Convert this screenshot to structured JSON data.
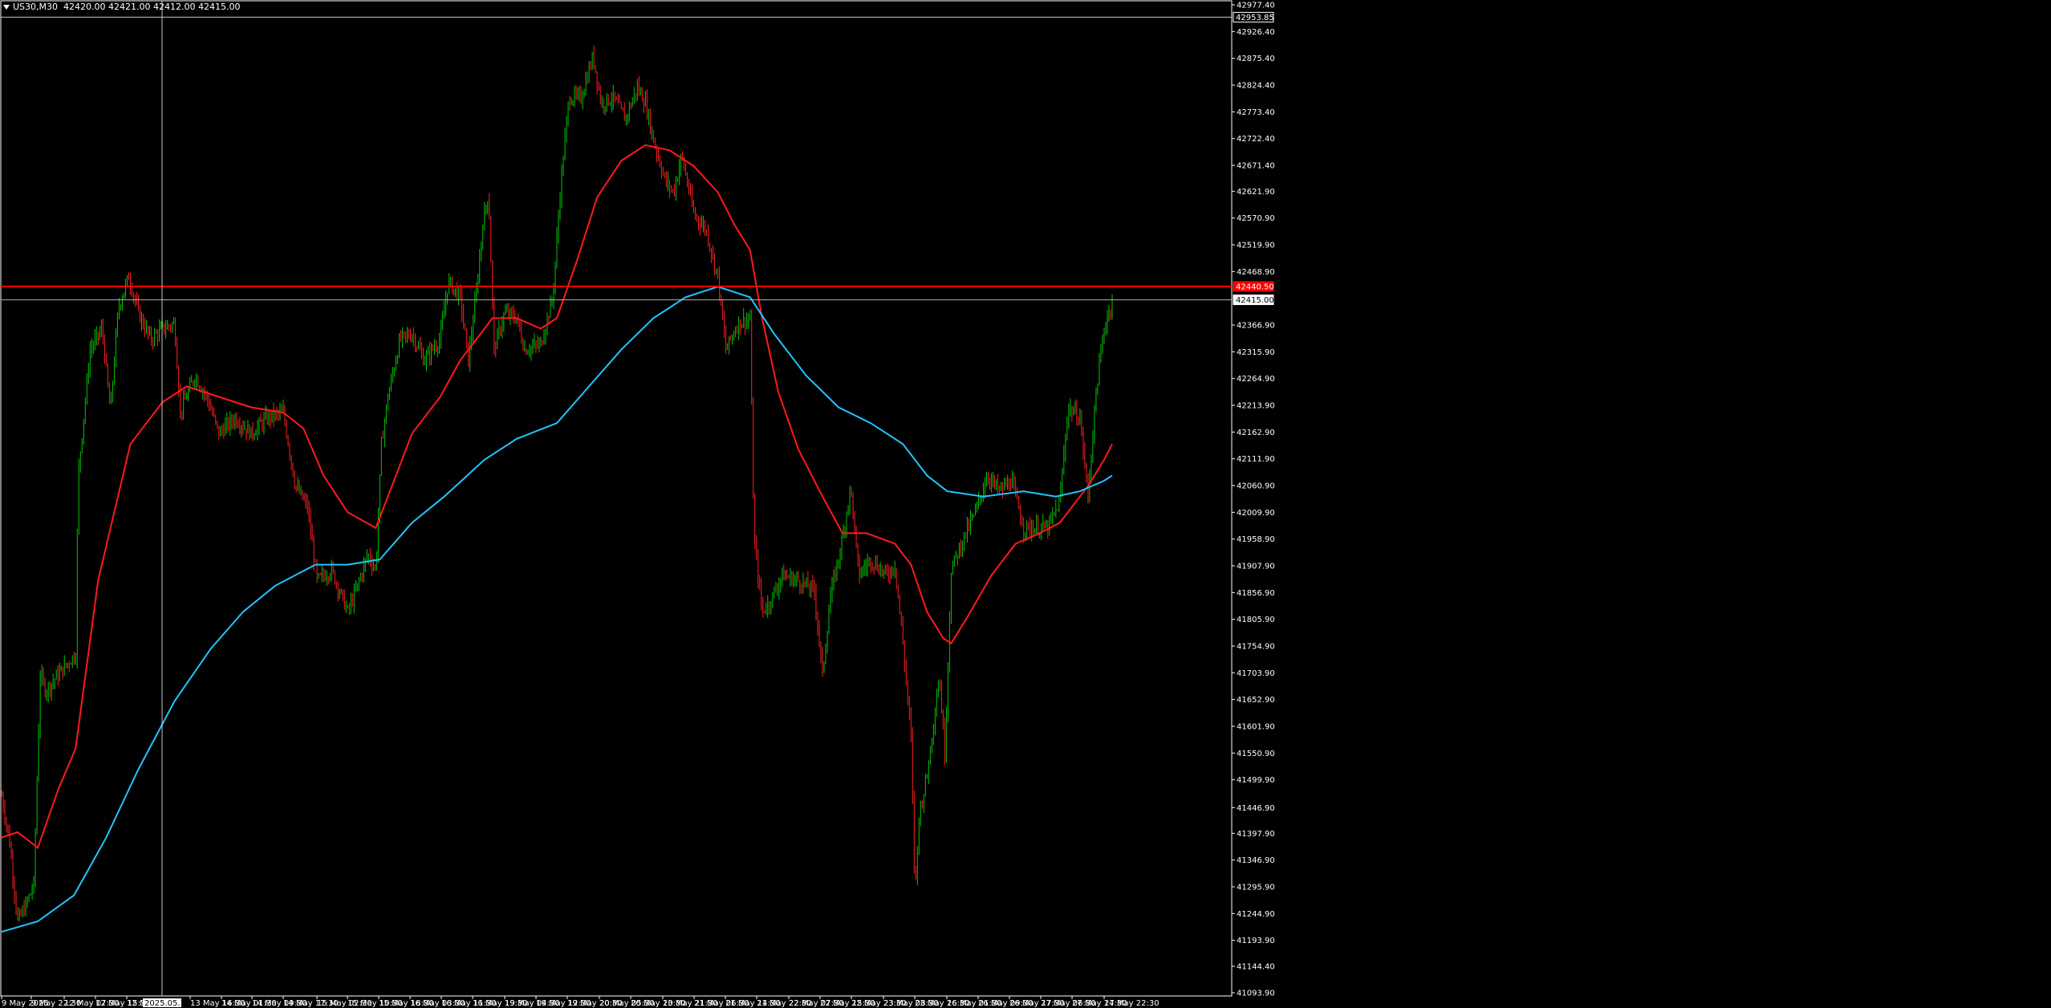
{
  "header": {
    "symbol": "US30,M30",
    "ohlc": "42420.00 42421.00 42412.00 42415.00"
  },
  "colors": {
    "background": "#000000",
    "bull": "#00c800",
    "bear": "#ff2020",
    "ma_fast": "#ff1a1a",
    "ma_slow": "#22c4ff",
    "hline": "#ff0000",
    "frame": "#ffffff",
    "crosshair": "#c8c8c8"
  },
  "chart_data": {
    "type": "candlestick",
    "symbol": "US30",
    "timeframe": "M30",
    "ylim": [
      41093.9,
      42977.4
    ],
    "price_ticks": [
      "42977.40",
      "42926.40",
      "42875.40",
      "42824.40",
      "42773.40",
      "42722.40",
      "42671.40",
      "42621.90",
      "42570.90",
      "42519.90",
      "42468.90",
      "42366.90",
      "42315.90",
      "42264.90",
      "42213.90",
      "42162.90",
      "42111.90",
      "42060.90",
      "42009.90",
      "41958.90",
      "41907.90",
      "41856.90",
      "41805.90",
      "41754.90",
      "41703.90",
      "41652.90",
      "41601.90",
      "41550.90",
      "41499.90",
      "41446.90",
      "41397.90",
      "41346.90",
      "41295.90",
      "41244.90",
      "41193.90",
      "41144.40",
      "41093.90"
    ],
    "time_labels": [
      "9 May 2025",
      "9 May 22:30",
      "12 May 07:30",
      "12 May 15:30",
      "12 May",
      "2025.05.13 09:00",
      "13 May 16:30",
      "14 May 01:30",
      "14 May 09:30",
      "14 May 17:30",
      "15 May 02:30",
      "15 May 10:30",
      "15 May 18:30",
      "16 May 03:30",
      "16 May 11:30",
      "16 May 19:30",
      "19 May 04:30",
      "19 May 12:30",
      "19 May 20:30",
      "20 May 05:30",
      "20 May 13:30",
      "20 May 21:30",
      "21 May 06:30",
      "21 May 14:30",
      "21 May 22:30",
      "22 May 07:30",
      "22 May 15:30",
      "22 May 23:30",
      "23 May 08:30",
      "23 May 16:30",
      "26 May 01:30",
      "26 May 09:30",
      "26 May 17:30",
      "27 May 06:30",
      "27 May 14:30",
      "27 May 22:30"
    ],
    "crosshair_time": "2025.05.13 09:00",
    "crosshair_price": "42953.85",
    "ask_price": "42440.50",
    "bid_price": "42415.00",
    "price_path": [
      [
        0,
        41470
      ],
      [
        10,
        41380
      ],
      [
        20,
        41230
      ],
      [
        30,
        41260
      ],
      [
        40,
        41300
      ],
      [
        48,
        41700
      ],
      [
        55,
        41670
      ],
      [
        70,
        41700
      ],
      [
        92,
        41740
      ],
      [
        95,
        42080
      ],
      [
        110,
        42320
      ],
      [
        125,
        42360
      ],
      [
        135,
        42200
      ],
      [
        145,
        42400
      ],
      [
        158,
        42460
      ],
      [
        170,
        42390
      ],
      [
        185,
        42340
      ],
      [
        200,
        42360
      ],
      [
        215,
        42370
      ],
      [
        222,
        42200
      ],
      [
        240,
        42270
      ],
      [
        255,
        42230
      ],
      [
        270,
        42160
      ],
      [
        290,
        42190
      ],
      [
        310,
        42160
      ],
      [
        330,
        42190
      ],
      [
        350,
        42200
      ],
      [
        365,
        42060
      ],
      [
        380,
        42020
      ],
      [
        392,
        41880
      ],
      [
        410,
        41900
      ],
      [
        430,
        41820
      ],
      [
        440,
        41860
      ],
      [
        455,
        41930
      ],
      [
        465,
        41900
      ],
      [
        472,
        42140
      ],
      [
        480,
        42230
      ],
      [
        495,
        42340
      ],
      [
        510,
        42350
      ],
      [
        525,
        42300
      ],
      [
        545,
        42340
      ],
      [
        555,
        42450
      ],
      [
        570,
        42420
      ],
      [
        580,
        42300
      ],
      [
        590,
        42430
      ],
      [
        598,
        42560
      ],
      [
        605,
        42620
      ],
      [
        612,
        42320
      ],
      [
        625,
        42390
      ],
      [
        640,
        42380
      ],
      [
        650,
        42320
      ],
      [
        670,
        42330
      ],
      [
        685,
        42420
      ],
      [
        695,
        42640
      ],
      [
        705,
        42800
      ],
      [
        720,
        42800
      ],
      [
        735,
        42880
      ],
      [
        745,
        42790
      ],
      [
        760,
        42800
      ],
      [
        775,
        42760
      ],
      [
        790,
        42820
      ],
      [
        800,
        42790
      ],
      [
        810,
        42720
      ],
      [
        825,
        42640
      ],
      [
        835,
        42620
      ],
      [
        845,
        42690
      ],
      [
        860,
        42580
      ],
      [
        875,
        42550
      ],
      [
        890,
        42460
      ],
      [
        900,
        42320
      ],
      [
        915,
        42370
      ],
      [
        930,
        42380
      ],
      [
        935,
        41960
      ],
      [
        945,
        41820
      ],
      [
        955,
        41840
      ],
      [
        970,
        41890
      ],
      [
        990,
        41880
      ],
      [
        1010,
        41860
      ],
      [
        1020,
        41700
      ],
      [
        1030,
        41850
      ],
      [
        1045,
        41960
      ],
      [
        1055,
        42060
      ],
      [
        1065,
        41890
      ],
      [
        1080,
        41920
      ],
      [
        1100,
        41890
      ],
      [
        1110,
        41910
      ],
      [
        1120,
        41760
      ],
      [
        1130,
        41580
      ],
      [
        1135,
        41280
      ],
      [
        1140,
        41430
      ],
      [
        1150,
        41510
      ],
      [
        1165,
        41700
      ],
      [
        1172,
        41550
      ],
      [
        1180,
        41900
      ],
      [
        1195,
        41960
      ],
      [
        1210,
        42010
      ],
      [
        1225,
        42080
      ],
      [
        1240,
        42050
      ],
      [
        1255,
        42070
      ],
      [
        1270,
        41980
      ],
      [
        1285,
        41980
      ],
      [
        1300,
        41980
      ],
      [
        1315,
        42030
      ],
      [
        1325,
        42210
      ],
      [
        1340,
        42190
      ],
      [
        1350,
        42040
      ],
      [
        1360,
        42240
      ],
      [
        1370,
        42360
      ],
      [
        1380,
        42415
      ]
    ],
    "ma_fast": [
      [
        0,
        41390
      ],
      [
        20,
        41400
      ],
      [
        45,
        41370
      ],
      [
        70,
        41480
      ],
      [
        92,
        41560
      ],
      [
        120,
        41880
      ],
      [
        160,
        42140
      ],
      [
        200,
        42220
      ],
      [
        230,
        42250
      ],
      [
        270,
        42230
      ],
      [
        310,
        42210
      ],
      [
        350,
        42200
      ],
      [
        375,
        42170
      ],
      [
        400,
        42080
      ],
      [
        430,
        42010
      ],
      [
        465,
        41980
      ],
      [
        480,
        42040
      ],
      [
        510,
        42160
      ],
      [
        545,
        42230
      ],
      [
        570,
        42300
      ],
      [
        590,
        42340
      ],
      [
        610,
        42380
      ],
      [
        640,
        42380
      ],
      [
        670,
        42360
      ],
      [
        690,
        42380
      ],
      [
        715,
        42490
      ],
      [
        740,
        42610
      ],
      [
        770,
        42680
      ],
      [
        800,
        42710
      ],
      [
        830,
        42700
      ],
      [
        860,
        42670
      ],
      [
        890,
        42620
      ],
      [
        910,
        42560
      ],
      [
        930,
        42510
      ],
      [
        945,
        42380
      ],
      [
        965,
        42240
      ],
      [
        990,
        42130
      ],
      [
        1020,
        42040
      ],
      [
        1045,
        41970
      ],
      [
        1075,
        41970
      ],
      [
        1110,
        41950
      ],
      [
        1130,
        41910
      ],
      [
        1150,
        41820
      ],
      [
        1170,
        41770
      ],
      [
        1180,
        41760
      ],
      [
        1200,
        41810
      ],
      [
        1230,
        41890
      ],
      [
        1260,
        41950
      ],
      [
        1290,
        41970
      ],
      [
        1315,
        41990
      ],
      [
        1330,
        42020
      ],
      [
        1350,
        42060
      ],
      [
        1370,
        42110
      ],
      [
        1380,
        42140
      ]
    ],
    "ma_slow": [
      [
        0,
        41210
      ],
      [
        45,
        41230
      ],
      [
        90,
        41280
      ],
      [
        130,
        41390
      ],
      [
        170,
        41520
      ],
      [
        215,
        41650
      ],
      [
        260,
        41750
      ],
      [
        300,
        41820
      ],
      [
        340,
        41870
      ],
      [
        390,
        41910
      ],
      [
        430,
        41910
      ],
      [
        470,
        41920
      ],
      [
        510,
        41990
      ],
      [
        550,
        42040
      ],
      [
        600,
        42110
      ],
      [
        640,
        42150
      ],
      [
        690,
        42180
      ],
      [
        730,
        42250
      ],
      [
        770,
        42320
      ],
      [
        810,
        42380
      ],
      [
        850,
        42420
      ],
      [
        890,
        42440
      ],
      [
        930,
        42420
      ],
      [
        960,
        42350
      ],
      [
        1000,
        42270
      ],
      [
        1040,
        42210
      ],
      [
        1080,
        42180
      ],
      [
        1120,
        42140
      ],
      [
        1150,
        42080
      ],
      [
        1175,
        42050
      ],
      [
        1220,
        42040
      ],
      [
        1270,
        42050
      ],
      [
        1310,
        42040
      ],
      [
        1340,
        42050
      ],
      [
        1370,
        42070
      ],
      [
        1380,
        42080
      ]
    ],
    "grid": false,
    "legend": "none"
  }
}
